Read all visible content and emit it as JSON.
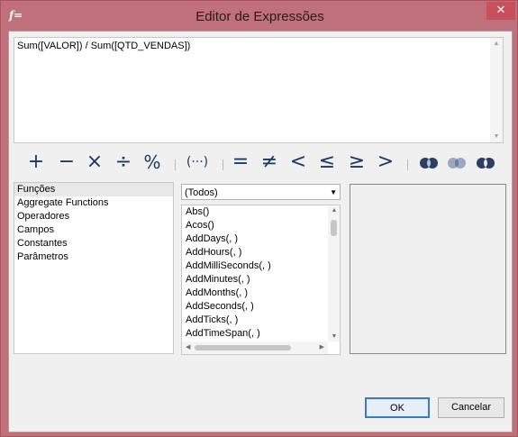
{
  "window": {
    "title": "Editor de Expressões",
    "icon": "formula-icon",
    "close_label": "✕"
  },
  "expression": {
    "text": "Sum([VALOR]) / Sum([QTD_VENDAS])"
  },
  "operators": [
    "+",
    "−",
    "×",
    "÷",
    "%",
    "(···)",
    "=",
    "≠",
    "<",
    "≤",
    "≥",
    ">"
  ],
  "categories": {
    "items": [
      "Funções",
      "Aggregate Functions",
      "Operadores",
      "Campos",
      "Constantes",
      "Parâmetros"
    ],
    "selected": "Funções"
  },
  "filter": {
    "value": "(Todos)"
  },
  "functions": {
    "items": [
      "Abs()",
      "Acos()",
      "AddDays(, )",
      "AddHours(, )",
      "AddMilliSeconds(, )",
      "AddMinutes(, )",
      "AddMonths(, )",
      "AddSeconds(, )",
      "AddTicks(, )",
      "AddTimeSpan(, )"
    ]
  },
  "buttons": {
    "ok": "OK",
    "cancel": "Cancelar"
  },
  "colors": {
    "frame": "#c0707a",
    "operator": "#1a3a66",
    "ok_border": "#3a78c8"
  }
}
